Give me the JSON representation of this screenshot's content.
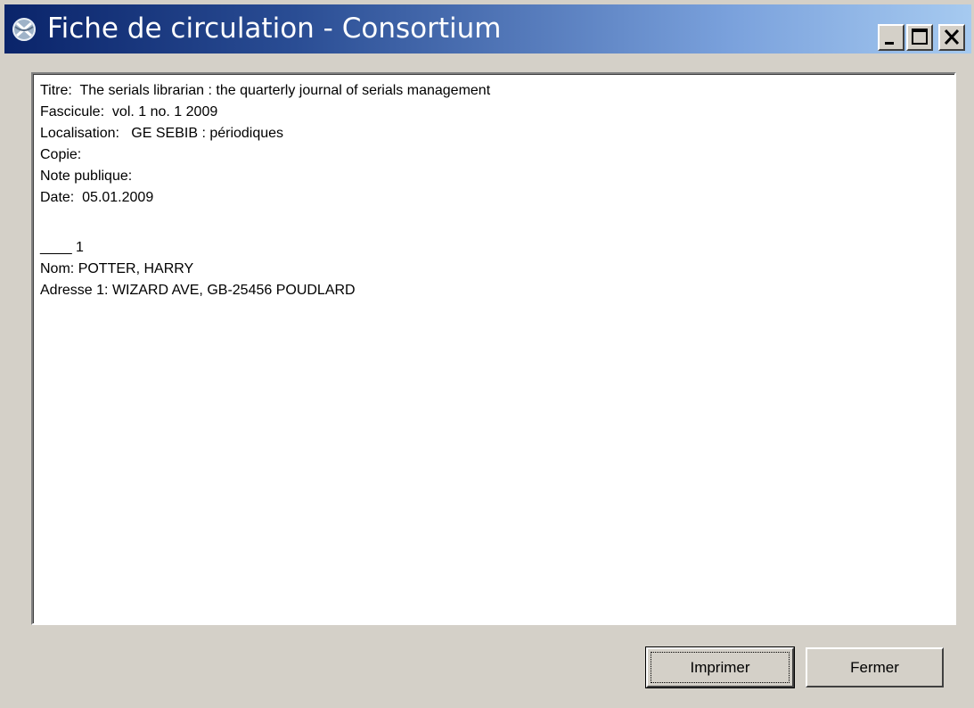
{
  "window": {
    "title": "Fiche de circulation - Consortium",
    "icon": "app-globe-icon"
  },
  "titlebar_buttons": {
    "minimize": "minimize-icon",
    "maximize": "maximize-icon",
    "close": "close-icon"
  },
  "record": {
    "titre_label": "Titre:",
    "titre_value": "The serials librarian : the quarterly journal of serials management",
    "fascicule_label": "Fascicule:",
    "fascicule_value": "vol. 1 no. 1 2009",
    "localisation_label": "Localisation:",
    "localisation_value": "GE SEBIB : périodiques",
    "copie_label": "Copie:",
    "note_label": "Note publique:",
    "date_label": "Date:",
    "date_value": "05.01.2009",
    "order_blank": "____",
    "order_number": "1",
    "nom_label": "Nom:",
    "nom_value": "POTTER, HARRY",
    "adresse_label": "Adresse 1:",
    "adresse_value": "WIZARD AVE, GB-25456 POUDLARD"
  },
  "buttons": {
    "print": "Imprimer",
    "close": "Fermer"
  },
  "colors": {
    "titlebar_start": "#0a246a",
    "titlebar_end": "#a6caf0",
    "window_bg": "#d4d0c8",
    "content_bg": "#ffffff"
  }
}
